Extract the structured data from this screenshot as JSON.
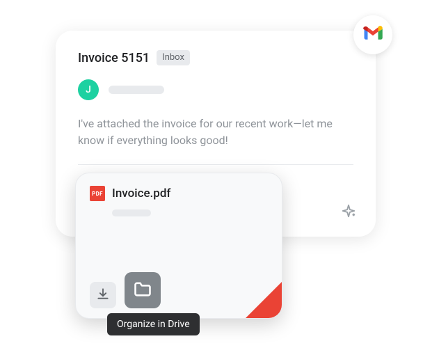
{
  "app": {
    "name": "Gmail"
  },
  "email": {
    "subject": "Invoice 5151",
    "label": "Inbox",
    "avatar_initial": "J",
    "body": "I've attached the invoice for our recent work—let me know if everything looks good!"
  },
  "attachment": {
    "badge_text": "PDF",
    "filename": "Invoice.pdf"
  },
  "tooltip": {
    "text": "Organize in Drive"
  }
}
